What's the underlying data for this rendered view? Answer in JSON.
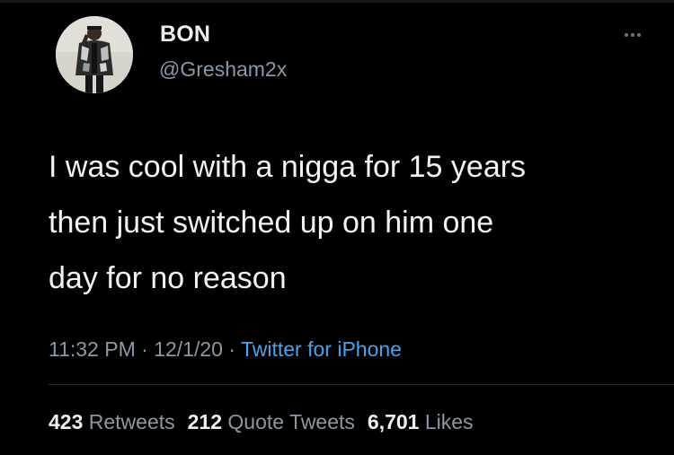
{
  "tweet": {
    "author_name": "BON",
    "author_handle": "@Gresham2x",
    "more_icon": "ellipsis-icon",
    "text": "I was cool with a nigga for 15 years\nthen just switched up on him one\nday for no reason",
    "time": "11:32 PM",
    "separator": " · ",
    "date": "12/1/20",
    "source": "Twitter for iPhone",
    "stats": {
      "retweets_count": "423",
      "retweets_label": "Retweets",
      "quote_count": "212",
      "quote_label": "Quote Tweets",
      "likes_count": "6,701",
      "likes_label": "Likes"
    }
  },
  "colors": {
    "background": "#000000",
    "text": "#f2f2f2",
    "secondary": "#8b98a5",
    "link": "#4aa3ea"
  }
}
